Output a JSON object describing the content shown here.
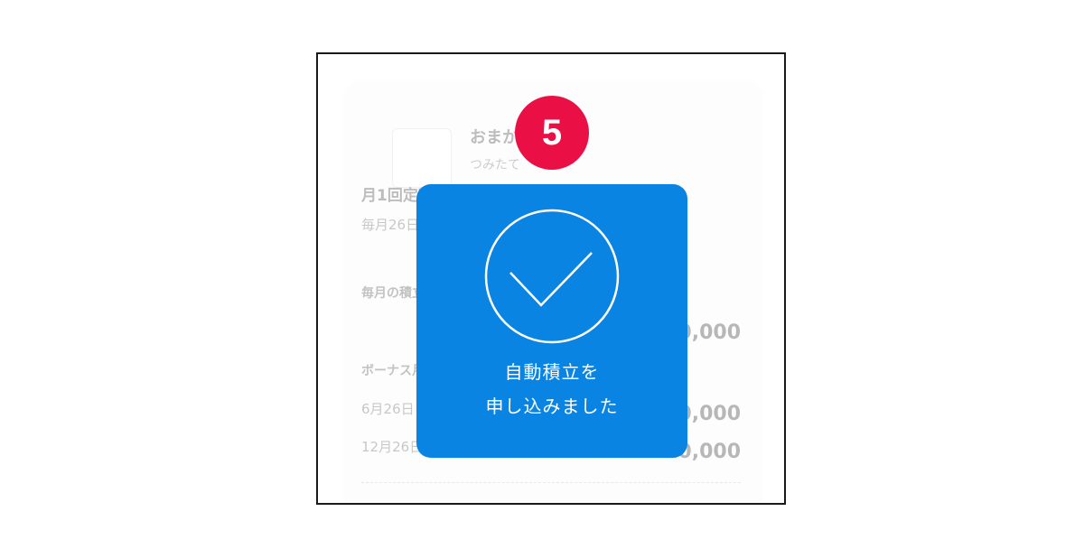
{
  "step_badge": {
    "number": "5",
    "color": "#ea1045"
  },
  "background_screen": {
    "fund_name": "おまかせ",
    "fund_sub": "つみたて",
    "plan_title": "月1回定額",
    "plan_date": "毎月26日",
    "monthly_label": "毎月の積立金額",
    "monthly_amount": "¥10,000",
    "bonus_label": "ボーナス月",
    "bonus_date_1": "6月26日",
    "bonus_amount_1": "¥10,000",
    "bonus_date_2": "12月26日",
    "bonus_amount_2": "¥10,000"
  },
  "toast": {
    "icon": "check-circle-icon",
    "line1": "自動積立を",
    "line2": "申し込みました",
    "color": "#0a84e3"
  }
}
